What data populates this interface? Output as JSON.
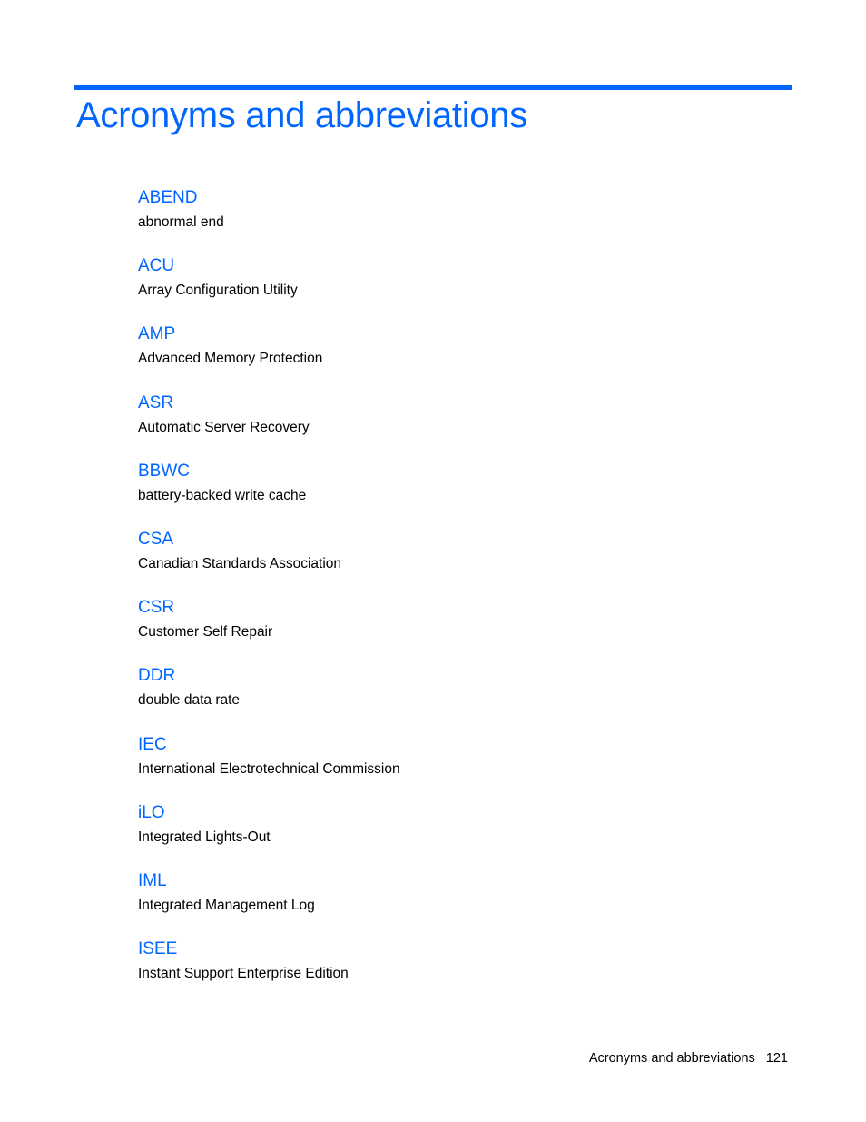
{
  "page": {
    "title": "Acronyms and abbreviations",
    "accent_color": "#0066ff",
    "entries": [
      {
        "term": "ABEND",
        "definition": "abnormal end"
      },
      {
        "term": "ACU",
        "definition": "Array Configuration Utility"
      },
      {
        "term": "AMP",
        "definition": "Advanced Memory Protection"
      },
      {
        "term": "ASR",
        "definition": "Automatic Server Recovery"
      },
      {
        "term": "BBWC",
        "definition": "battery-backed write cache"
      },
      {
        "term": "CSA",
        "definition": "Canadian Standards Association"
      },
      {
        "term": "CSR",
        "definition": "Customer Self Repair"
      },
      {
        "term": "DDR",
        "definition": "double data rate"
      },
      {
        "term": "IEC",
        "definition": "International Electrotechnical Commission"
      },
      {
        "term": "iLO",
        "definition": "Integrated Lights-Out"
      },
      {
        "term": "IML",
        "definition": "Integrated Management Log"
      },
      {
        "term": "ISEE",
        "definition": "Instant Support Enterprise Edition"
      }
    ]
  },
  "footer": {
    "section": "Acronyms and abbreviations",
    "page_number": "121"
  }
}
